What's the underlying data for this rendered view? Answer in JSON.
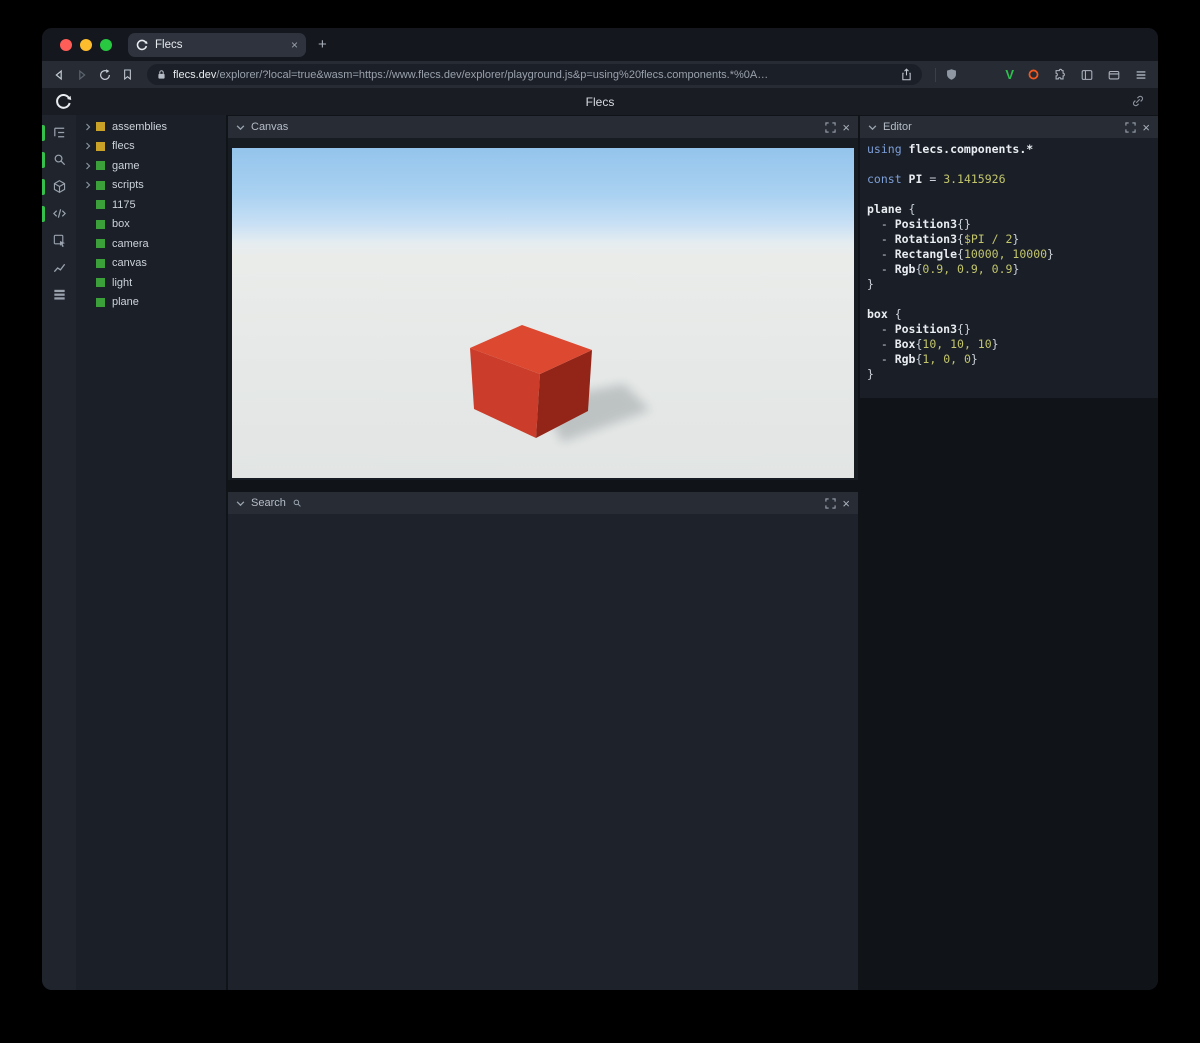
{
  "browser": {
    "tab_title": "Flecs",
    "url_domain": "flecs.dev",
    "url_path": "/explorer/?local=true&wasm=https://www.flecs.dev/explorer/playground.js&p=using%20flecs.components.*%0A…",
    "new_tab_glyph": "+",
    "tab_close_glyph": "×"
  },
  "app": {
    "title": "Flecs"
  },
  "sidebar_icons": [
    "hierarchy-icon",
    "search-icon",
    "cube-icon",
    "code-icon",
    "inspect-icon",
    "chart-icon",
    "rows-icon"
  ],
  "tree": {
    "items": [
      {
        "label": "assemblies",
        "color": "#c9a227",
        "expandable": true
      },
      {
        "label": "flecs",
        "color": "#c9a227",
        "expandable": true
      },
      {
        "label": "game",
        "color": "#3ba039",
        "expandable": true
      },
      {
        "label": "scripts",
        "color": "#3ba039",
        "expandable": true
      },
      {
        "label": "1175",
        "color": "#3ba039",
        "expandable": false
      },
      {
        "label": "box",
        "color": "#3ba039",
        "expandable": false
      },
      {
        "label": "camera",
        "color": "#3ba039",
        "expandable": false
      },
      {
        "label": "canvas",
        "color": "#3ba039",
        "expandable": false
      },
      {
        "label": "light",
        "color": "#3ba039",
        "expandable": false
      },
      {
        "label": "plane",
        "color": "#3ba039",
        "expandable": false
      }
    ]
  },
  "panels": {
    "canvas": {
      "title": "Canvas"
    },
    "search": {
      "title": "Search"
    },
    "editor": {
      "title": "Editor"
    },
    "close_glyph": "×"
  },
  "editor": {
    "lines": [
      [
        {
          "c": "kw",
          "t": "using "
        },
        {
          "c": "id",
          "t": "flecs.components.*"
        }
      ],
      [],
      [
        {
          "c": "kw",
          "t": "const "
        },
        {
          "c": "id",
          "t": "PI"
        },
        {
          "c": "pun",
          "t": " = "
        },
        {
          "c": "num",
          "t": "3.1415926"
        }
      ],
      [],
      [
        {
          "c": "id",
          "t": "plane"
        },
        {
          "c": "pun",
          "t": " {"
        }
      ],
      [
        {
          "c": "pun",
          "t": "  - "
        },
        {
          "c": "id",
          "t": "Position3"
        },
        {
          "c": "pun",
          "t": "{}"
        }
      ],
      [
        {
          "c": "pun",
          "t": "  - "
        },
        {
          "c": "id",
          "t": "Rotation3"
        },
        {
          "c": "pun",
          "t": "{"
        },
        {
          "c": "num",
          "t": "$PI / 2"
        },
        {
          "c": "pun",
          "t": "}"
        }
      ],
      [
        {
          "c": "pun",
          "t": "  - "
        },
        {
          "c": "id",
          "t": "Rectangle"
        },
        {
          "c": "pun",
          "t": "{"
        },
        {
          "c": "num",
          "t": "10000, 10000"
        },
        {
          "c": "pun",
          "t": "}"
        }
      ],
      [
        {
          "c": "pun",
          "t": "  - "
        },
        {
          "c": "id",
          "t": "Rgb"
        },
        {
          "c": "pun",
          "t": "{"
        },
        {
          "c": "num",
          "t": "0.9, 0.9, 0.9"
        },
        {
          "c": "pun",
          "t": "}"
        }
      ],
      [
        {
          "c": "pun",
          "t": "}"
        }
      ],
      [],
      [
        {
          "c": "id",
          "t": "box"
        },
        {
          "c": "pun",
          "t": " {"
        }
      ],
      [
        {
          "c": "pun",
          "t": "  - "
        },
        {
          "c": "id",
          "t": "Position3"
        },
        {
          "c": "pun",
          "t": "{}"
        }
      ],
      [
        {
          "c": "pun",
          "t": "  - "
        },
        {
          "c": "id",
          "t": "Box"
        },
        {
          "c": "pun",
          "t": "{"
        },
        {
          "c": "num",
          "t": "10, 10, 10"
        },
        {
          "c": "pun",
          "t": "}"
        }
      ],
      [
        {
          "c": "pun",
          "t": "  - "
        },
        {
          "c": "id",
          "t": "Rgb"
        },
        {
          "c": "pun",
          "t": "{"
        },
        {
          "c": "num",
          "t": "1, 0, 0"
        },
        {
          "c": "pun",
          "t": "}"
        }
      ],
      [
        {
          "c": "pun",
          "t": "}"
        }
      ]
    ]
  },
  "scene": {
    "sky_top": "#94c4ec",
    "ground": "#e5e8e7",
    "box_top": "#dc4830",
    "box_front": "#cb3d2a",
    "box_right": "#932518",
    "shadow": "#8f9699"
  },
  "accent": {
    "active_indicator": "#36bf4c",
    "entity_green": "#3ba039",
    "entity_yellow": "#c9a227"
  }
}
